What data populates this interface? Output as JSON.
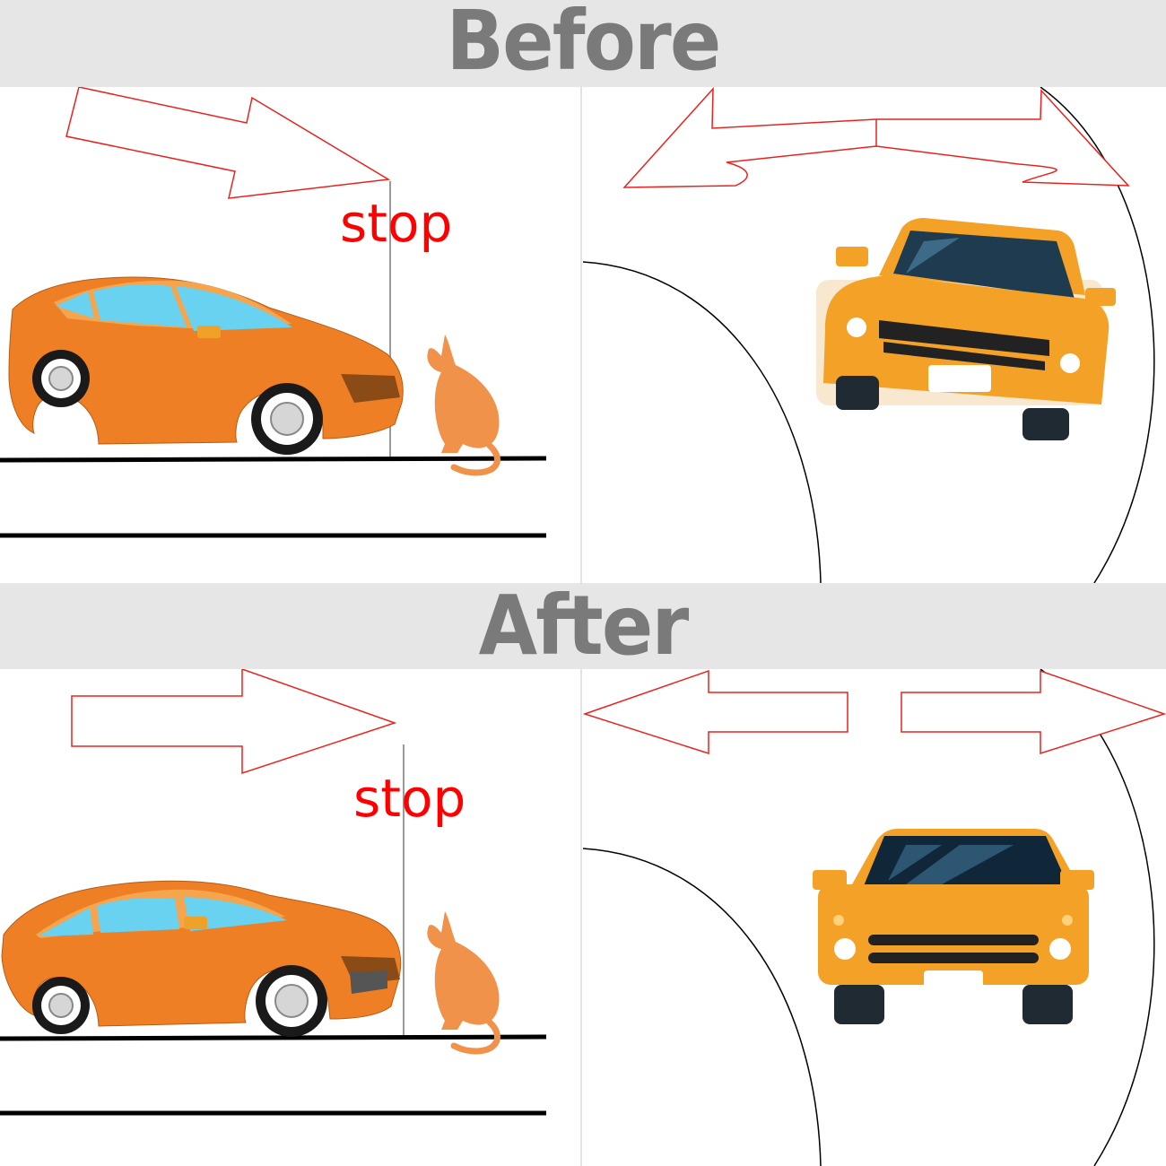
{
  "headings": {
    "before": "Before",
    "after": "After"
  },
  "panels": {
    "before_left_label": "stop",
    "after_left_label": "stop"
  },
  "colors": {
    "banner_bg": "#e6e6e6",
    "banner_text": "#7a7a7a",
    "arrow_outline": "#e8231f",
    "stop_text": "#ff0000",
    "car_body": "#ee7f25",
    "suv_body": "#f3a227",
    "cat": "#f0924a"
  },
  "icons": [
    "arrow-right-icon",
    "arrow-both-icon",
    "arrow-left-icon",
    "car-side-icon",
    "car-front-icon",
    "cat-icon",
    "stop-line-icon"
  ]
}
